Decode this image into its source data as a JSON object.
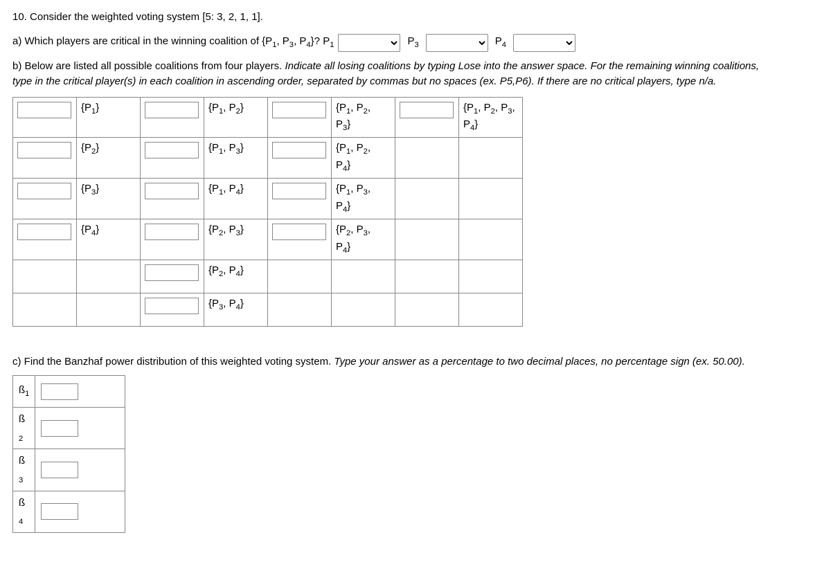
{
  "question_number": "10.",
  "question_text": "Consider the weighted voting system [5: 3, 2, 1, 1].",
  "part_a": {
    "prefix": "a) Which players are critical in the winning coalition of {P",
    "sub1": "1",
    "mid1": ", P",
    "sub3": "3",
    "mid2": ", P",
    "sub4": "4",
    "suffix": "}? P",
    "sub_p1": "1",
    "label_p3": "P",
    "sub_p3": "3",
    "label_p4": "P",
    "sub_p4": "4"
  },
  "part_b": {
    "line1": "b) Below are listed all possible coalitions from four players.",
    "italic1": "Indicate all losing coalitions by typing Lose into the answer space. For the remaining winning coalitions,",
    "italic2": "type in the critical player(s) in each coalition in ascending order, separated by commas but no spaces (ex. P5,P6). If there are no critical players, type n/a."
  },
  "coalitions": {
    "c1": [
      "{P",
      "1",
      "}"
    ],
    "c2": [
      "{P",
      "2",
      "}"
    ],
    "c3": [
      "{P",
      "3",
      "}"
    ],
    "c4": [
      "{P",
      "4",
      "}"
    ],
    "c12": [
      "{P",
      "1",
      ", P",
      "2",
      "}"
    ],
    "c13": [
      "{P",
      "1",
      ", P",
      "3",
      "}"
    ],
    "c14": [
      "{P",
      "1",
      ", P",
      "4",
      "}"
    ],
    "c23": [
      "{P",
      "2",
      ", P",
      "3",
      "}"
    ],
    "c24": [
      "{P",
      "2",
      ", P",
      "4",
      "}"
    ],
    "c34": [
      "{P",
      "3",
      ", P",
      "4",
      "}"
    ],
    "c123": [
      "{P",
      "1",
      ", P",
      "2",
      ",",
      "P",
      "3",
      "}"
    ],
    "c124": [
      "{P",
      "1",
      ", P",
      "2",
      ",",
      "P",
      "4",
      "}"
    ],
    "c134": [
      "{P",
      "1",
      ", P",
      "3",
      ",",
      "P",
      "4",
      "}"
    ],
    "c234": [
      "{P",
      "2",
      ", P",
      "3",
      ",",
      "P",
      "4",
      "}"
    ],
    "c1234": [
      "{P",
      "1",
      ", P",
      "2",
      ", P",
      "3",
      ",",
      "P",
      "4",
      "}"
    ]
  },
  "part_c": {
    "prefix": "c) Find the Banzhaf power distribution of this weighted voting system.",
    "italic": "Type your answer as a percentage to two decimal places, no percentage sign (ex. 50.00)."
  },
  "beta": {
    "b": "ß",
    "s1": "1",
    "s2": "2",
    "s3": "3",
    "s4": "4"
  }
}
